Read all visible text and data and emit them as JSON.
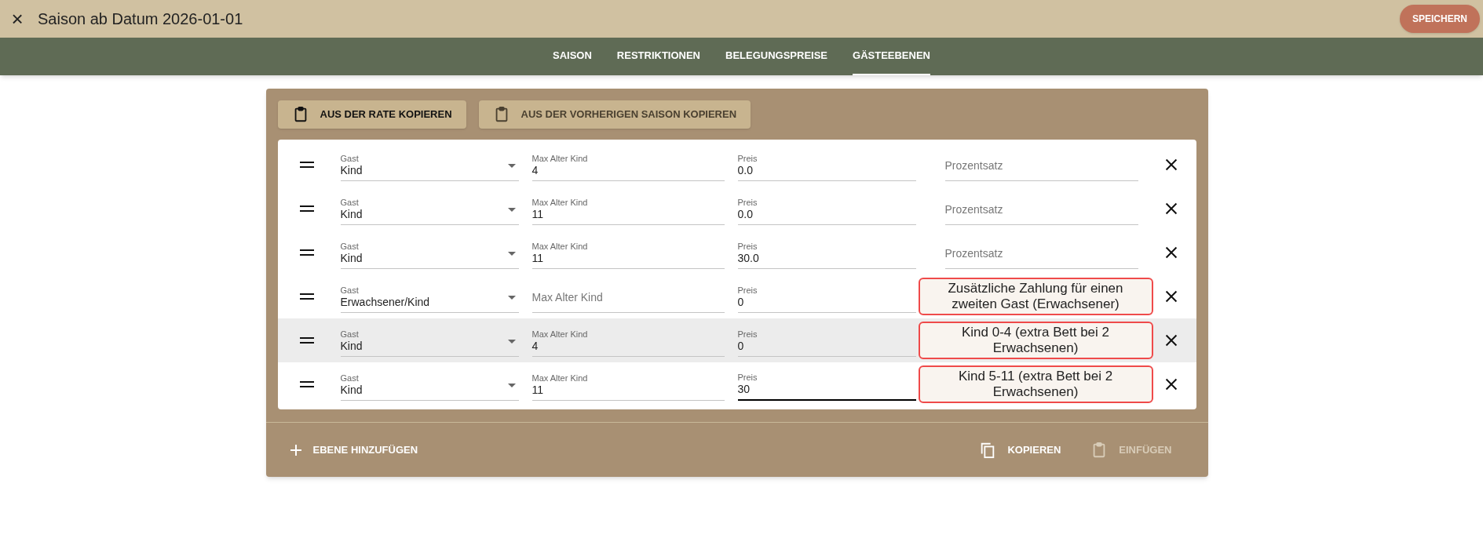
{
  "header": {
    "close": "×",
    "title": "Saison ab Datum 2026-01-01",
    "save": "SPEICHERN"
  },
  "tabs": [
    {
      "label": "SAISON",
      "selected": false
    },
    {
      "label": "RESTRIKTIONEN",
      "selected": false
    },
    {
      "label": "BELEGUNGSPREISE",
      "selected": false
    },
    {
      "label": "GÄSTEEBENEN",
      "selected": true
    }
  ],
  "copy_buttons": [
    {
      "label": "AUS DER RATE KOPIEREN",
      "disabled": false
    },
    {
      "label": "AUS DER VORHERIGEN SAISON KOPIEREN",
      "disabled": true
    }
  ],
  "rows": [
    {
      "gast_label": "Gast",
      "gast": "Kind",
      "age_label": "Max Alter Kind",
      "age": "4",
      "price_label": "Preis",
      "price": "0.0",
      "percent_placeholder": "Prozentsatz",
      "highlighted": false,
      "focused": false
    },
    {
      "gast_label": "Gast",
      "gast": "Kind",
      "age_label": "Max Alter Kind",
      "age": "11",
      "price_label": "Preis",
      "price": "0.0",
      "percent_placeholder": "Prozentsatz",
      "highlighted": false,
      "focused": false
    },
    {
      "gast_label": "Gast",
      "gast": "Kind",
      "age_label": "Max Alter Kind",
      "age": "11",
      "price_label": "Preis",
      "price": "30.0",
      "percent_placeholder": "Prozentsatz",
      "highlighted": false,
      "focused": false
    },
    {
      "gast_label": "Gast",
      "gast": "Erwachsener/Kind",
      "age_placeholder": "Max Alter Kind",
      "price_label": "Preis",
      "price": "0",
      "annotation": "Zusätzliche Zahlung für einen zweiten Gast (Erwachsener)",
      "highlighted": false,
      "focused": false
    },
    {
      "gast_label": "Gast",
      "gast": "Kind",
      "age_label": "Max Alter Kind",
      "age": "4",
      "price_label": "Preis",
      "price": "0",
      "annotation": "Kind 0-4 (extra Bett bei 2 Erwachsenen)",
      "highlighted": true,
      "focused": false
    },
    {
      "gast_label": "Gast",
      "gast": "Kind",
      "age_label": "Max Alter Kind",
      "age": "11",
      "price_label": "Preis",
      "price": "30",
      "annotation": "Kind 5-11 (extra Bett bei 2 Erwachsenen)",
      "highlighted": false,
      "focused": true
    }
  ],
  "footer": {
    "add": "EBENE HINZUFÜGEN",
    "copy": {
      "label": "KOPIEREN",
      "disabled": false
    },
    "paste": {
      "label": "EINFÜGEN",
      "disabled": true
    }
  }
}
